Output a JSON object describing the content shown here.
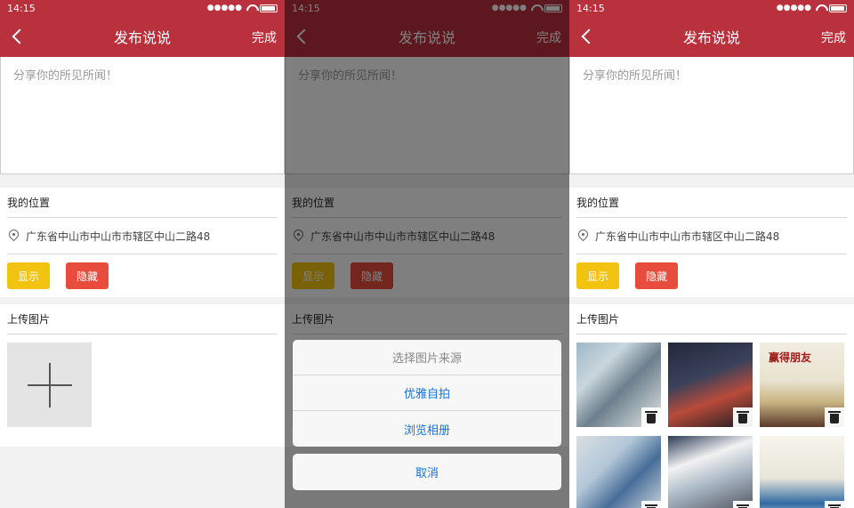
{
  "status": {
    "time": "14:15",
    "signal": "●●●●●"
  },
  "nav": {
    "title": "发布说说",
    "done": "完成"
  },
  "post": {
    "placeholder": "分享你的所见所闻！"
  },
  "location": {
    "section_title": "我的位置",
    "address": "广东省中山市中山市市辖区中山二路48",
    "show_label": "显示",
    "hide_label": "隐藏"
  },
  "upload": {
    "section_title": "上传图片"
  },
  "action_sheet": {
    "title": "选择图片来源",
    "options": [
      "优雅自拍",
      "浏览相册"
    ],
    "cancel": "取消"
  },
  "thumb_book_text": "赢得朋友",
  "colors": {
    "brand": "#b8313c",
    "show_button": "#f2c311",
    "hide_button": "#e74c3c",
    "action_blue": "#1a73d9"
  },
  "icons": [
    "back-arrow-icon",
    "location-pin-icon",
    "add-photo-icon",
    "trash-icon",
    "wifi-icon",
    "battery-icon"
  ]
}
